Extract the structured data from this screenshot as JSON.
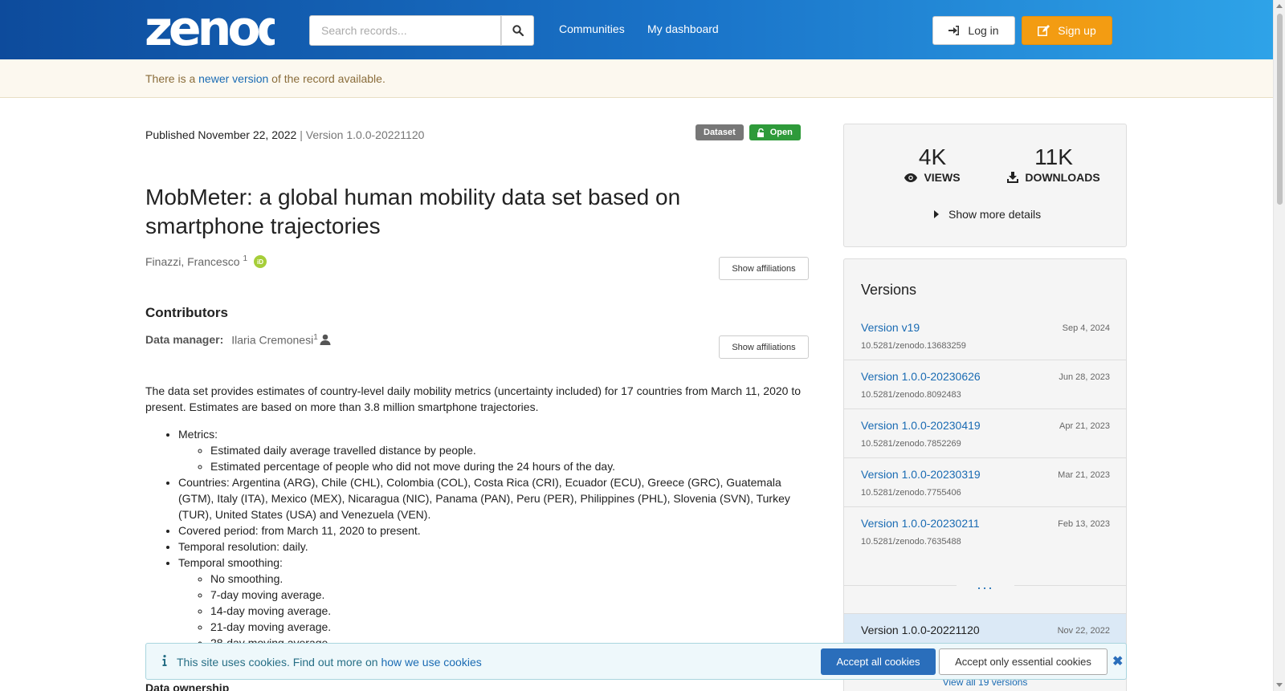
{
  "header": {
    "logo_text": "zenodo",
    "search_placeholder": "Search records...",
    "nav": [
      "Communities",
      "My dashboard"
    ],
    "login_label": "Log in",
    "signup_label": "Sign up"
  },
  "banner": {
    "prefix": "There is a ",
    "link": "newer version",
    "suffix": " of the record available."
  },
  "record": {
    "published": "Published November 22, 2022",
    "separator": " | ",
    "version": "Version 1.0.0-20221120",
    "badge_type": "Dataset",
    "badge_access": "Open",
    "title": "MobMeter: a global human mobility data set based on smartphone trajectories",
    "creator": "Finazzi, Francesco",
    "creator_sup": "1",
    "orcid_label": "iD",
    "show_affiliations": "Show affiliations",
    "contributors_heading": "Contributors",
    "contributor_role": "Data manager:",
    "contributor_name": "Ilaria Cremonesi",
    "contributor_sup": "1",
    "description": "The data set provides estimates of country-level daily mobility metrics (uncertainty included) for 17 countries from March 11, 2020 to present. Estimates are based on more than 3.8 million smartphone trajectories.",
    "metrics_label": "Metrics:",
    "metrics": [
      "Estimated daily average travelled distance by people.",
      "Estimated percentage of people who did not move during the 24 hours of the day."
    ],
    "countries": "Countries: Argentina (ARG), Chile (CHL), Colombia (COL), Costa Rica (CRI), Ecuador (ECU), Greece (GRC), Guatemala (GTM), Italy (ITA), Mexico (MEX), Nicaragua (NIC), Panama (PAN), Peru (PER), Philippines (PHL), Slovenia (SVN), Turkey (TUR), United States (USA) and Venezuela (VEN).",
    "covered_period": "Covered period: from March 11, 2020 to present.",
    "temporal_resolution": "Temporal resolution: daily.",
    "smoothing_label": "Temporal smoothing:",
    "smoothing": [
      "No smoothing.",
      "7-day moving average.",
      "14-day moving average.",
      "21-day moving average.",
      "28-day moving average."
    ],
    "ownership_heading": "Data ownership"
  },
  "stats": {
    "views_value": "4K",
    "views_label": "VIEWS",
    "downloads_value": "11K",
    "downloads_label": "DOWNLOADS",
    "more_details": "Show more details"
  },
  "versions": {
    "heading": "Versions",
    "items": [
      {
        "name": "Version v19",
        "doi": "10.5281/zenodo.13683259",
        "date": "Sep 4, 2024"
      },
      {
        "name": "Version 1.0.0-20230626",
        "doi": "10.5281/zenodo.8092483",
        "date": "Jun 28, 2023"
      },
      {
        "name": "Version 1.0.0-20230419",
        "doi": "10.5281/zenodo.7852269",
        "date": "Apr 21, 2023"
      },
      {
        "name": "Version 1.0.0-20230319",
        "doi": "10.5281/zenodo.7755406",
        "date": "Mar 21, 2023"
      },
      {
        "name": "Version 1.0.0-20230211",
        "doi": "10.5281/zenodo.7635488",
        "date": "Feb 13, 2023"
      }
    ],
    "ellipsis": "...",
    "current": {
      "name": "Version 1.0.0-20221120",
      "date": "Nov 22, 2022"
    },
    "view_all": "View all 19 versions"
  },
  "cookie": {
    "text": "This site uses cookies. Find out more on ",
    "link": "how we use cookies",
    "accept_all": "Accept all cookies",
    "accept_essential": "Accept only essential cookies"
  }
}
